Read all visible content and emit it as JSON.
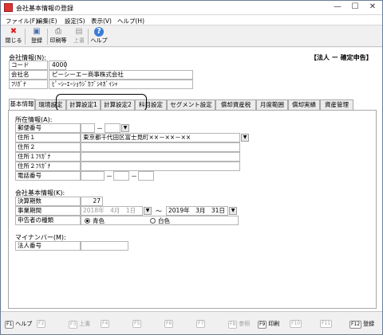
{
  "window": {
    "title": "会社基本情報の登録",
    "minimize_glyph": "—",
    "maximize_glyph": "☐",
    "close_glyph": "✕"
  },
  "menu": [
    "ファイル(F)",
    "編集(E)",
    "設定(S)",
    "表示(V)",
    "ヘルプ(H)"
  ],
  "toolbar": {
    "close": "閉じる",
    "register": "登録",
    "print_preview": "印刷等",
    "up": "上書",
    "help": "ヘルプ",
    "icons": {
      "close": "✖",
      "register": "💾",
      "print": "🖨",
      "up": "⇧",
      "help": "?"
    }
  },
  "header": {
    "section": "会社情報(N):",
    "badge": "【法人 ー 確定申告】",
    "code_label": "コード",
    "code_value": "4000",
    "name_label": "会社名",
    "name_value": "ピーシーエー商事株式会社",
    "kana_label": "ﾌﾘｶﾞﾅ",
    "kana_value": "ﾋﾟｰｼｰｴｰｼｮｳｼﾞｶﾌﾞｼｷｶﾞｲｼｬ"
  },
  "tabs": [
    "基本情報",
    "環境設定",
    "計算設定1",
    "計算設定2",
    "科目設定",
    "セグメント設定",
    "償却資産税",
    "月度範囲",
    "償却実績",
    "資産管理"
  ],
  "address": {
    "section": "所在情報(A):",
    "postal_label": "郵便番号",
    "postal_sep": "－",
    "addr1_label": "住所１",
    "addr1_value": "東京都千代田区富士見町××－××－××",
    "addr2_label": "住所２",
    "addr1_kana_label": "住所１ﾌﾘｶﾞﾅ",
    "addr2_kana_label": "住所２ﾌﾘｶﾞﾅ",
    "phone_label": "電話番号",
    "phone_sep": "－"
  },
  "basic": {
    "section": "会社基本情報(K):",
    "period_label": "決算期数",
    "period_value": "27",
    "term_label": "事業期間",
    "term_from": "2018年　4月　1日",
    "term_sep": "～",
    "term_to": "2019年　3月　31日",
    "filer_label": "申告者の種類",
    "filer_blue": "青色",
    "filer_white": "白色"
  },
  "mynumber": {
    "section": "マイナンバー(M):",
    "corp_label": "法人番号"
  },
  "fkeys": [
    {
      "key": "F1",
      "label": "ヘルプ",
      "enabled": true
    },
    {
      "key": "F2",
      "label": "",
      "enabled": false
    },
    {
      "key": "F3",
      "label": "上書",
      "enabled": false
    },
    {
      "key": "F4",
      "label": "",
      "enabled": false
    },
    {
      "key": "F5",
      "label": "",
      "enabled": false
    },
    {
      "key": "F6",
      "label": "",
      "enabled": false
    },
    {
      "key": "F7",
      "label": "",
      "enabled": false
    },
    {
      "key": "F8",
      "label": "参照",
      "enabled": false
    },
    {
      "key": "F9",
      "label": "印刷",
      "enabled": true
    },
    {
      "key": "F10",
      "label": "",
      "enabled": false
    },
    {
      "key": "F11",
      "label": "",
      "enabled": false
    },
    {
      "key": "F12",
      "label": "登録",
      "enabled": true
    }
  ]
}
